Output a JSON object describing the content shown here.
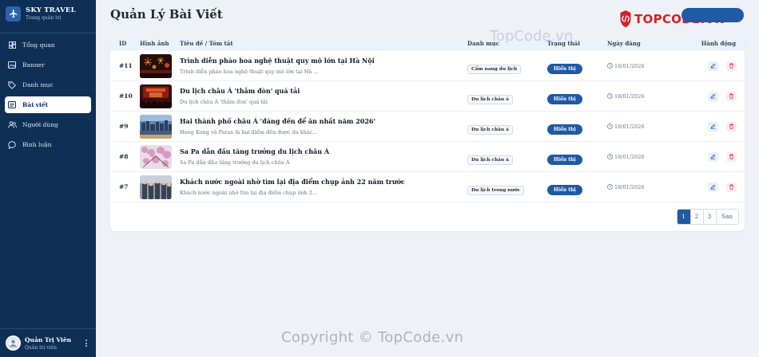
{
  "brand": {
    "title": "SKY TRAVEL",
    "subtitle": "Trang quản trị"
  },
  "sidebar": {
    "items": [
      {
        "label": "Tổng quan",
        "icon": "dashboard-icon"
      },
      {
        "label": "Banner",
        "icon": "image-icon"
      },
      {
        "label": "Danh mục",
        "icon": "tag-icon"
      },
      {
        "label": "Bài viết",
        "icon": "article-icon",
        "active": true
      },
      {
        "label": "Người dùng",
        "icon": "users-icon"
      },
      {
        "label": "Bình luận",
        "icon": "comment-icon"
      }
    ]
  },
  "user": {
    "name": "Quản Trị Viên",
    "role": "Quản trị viên"
  },
  "page": {
    "title": "Quản Lý Bài Viết"
  },
  "watermark": {
    "logo_text": "TOPCODE.VN",
    "center_text": "TopCode.vn",
    "copyright": "Copyright © TopCode.vn"
  },
  "table": {
    "headers": {
      "id": "ID",
      "image": "Hình ảnh",
      "title": "Tiêu đề / Tóm tắt",
      "category": "Danh mục",
      "status": "Trạng thái",
      "date": "Ngày đăng",
      "actions": "Hành động"
    },
    "rows": [
      {
        "id": "#11",
        "thumb": "fireworks",
        "title": "Trình diễn pháo hoa nghệ thuật quy mô lớn tại Hà Nội",
        "summary": "Trình diễn pháo hoa nghệ thuật quy mô lớn tại Hà ...",
        "category": "Cẩm nang du lịch",
        "status": "Hiển thị",
        "date": "18/01/2026"
      },
      {
        "id": "#10",
        "thumb": "night-crowd",
        "title": "Du lịch châu Á 'thắm đòn' quá tải",
        "summary": "Du lịch châu Á 'thắm đòn' quá tải",
        "category": "Du lịch châu á",
        "status": "Hiển thị",
        "date": "18/01/2026"
      },
      {
        "id": "#9",
        "thumb": "city-river",
        "title": "Hai thành phố châu Á 'đáng đến để ăn nhất năm 2026'",
        "summary": "Hong Kong và Patan là hai điểm đến được du khác...",
        "category": "Du lịch châu á",
        "status": "Hiển thị",
        "date": "18/01/2026"
      },
      {
        "id": "#8",
        "thumb": "blossom",
        "title": "Sa Pa dẫn đầu tăng trưởng du lịch châu Á",
        "summary": "Sa Pa dẫn đầu tăng trưởng du lịch châu Á",
        "category": "Du lịch châu á",
        "status": "Hiển thị",
        "date": "18/01/2026"
      },
      {
        "id": "#7",
        "thumb": "tourists",
        "title": "Khách nước ngoài nhờ tìm lại địa điểm chụp ảnh 22 năm trước",
        "summary": "Khách nước ngoài nhờ tìm lại địa điểm chụp ảnh 2...",
        "category": "Du lịch trong nước",
        "status": "Hiển thị",
        "date": "18/01/2026"
      }
    ]
  },
  "pagination": {
    "pages": [
      "1",
      "2",
      "3"
    ],
    "current": "1",
    "next": "Sau"
  },
  "colors": {
    "sidebar_bg": "#0f2f56",
    "accent": "#1f5aa3",
    "danger": "#d81f26"
  }
}
